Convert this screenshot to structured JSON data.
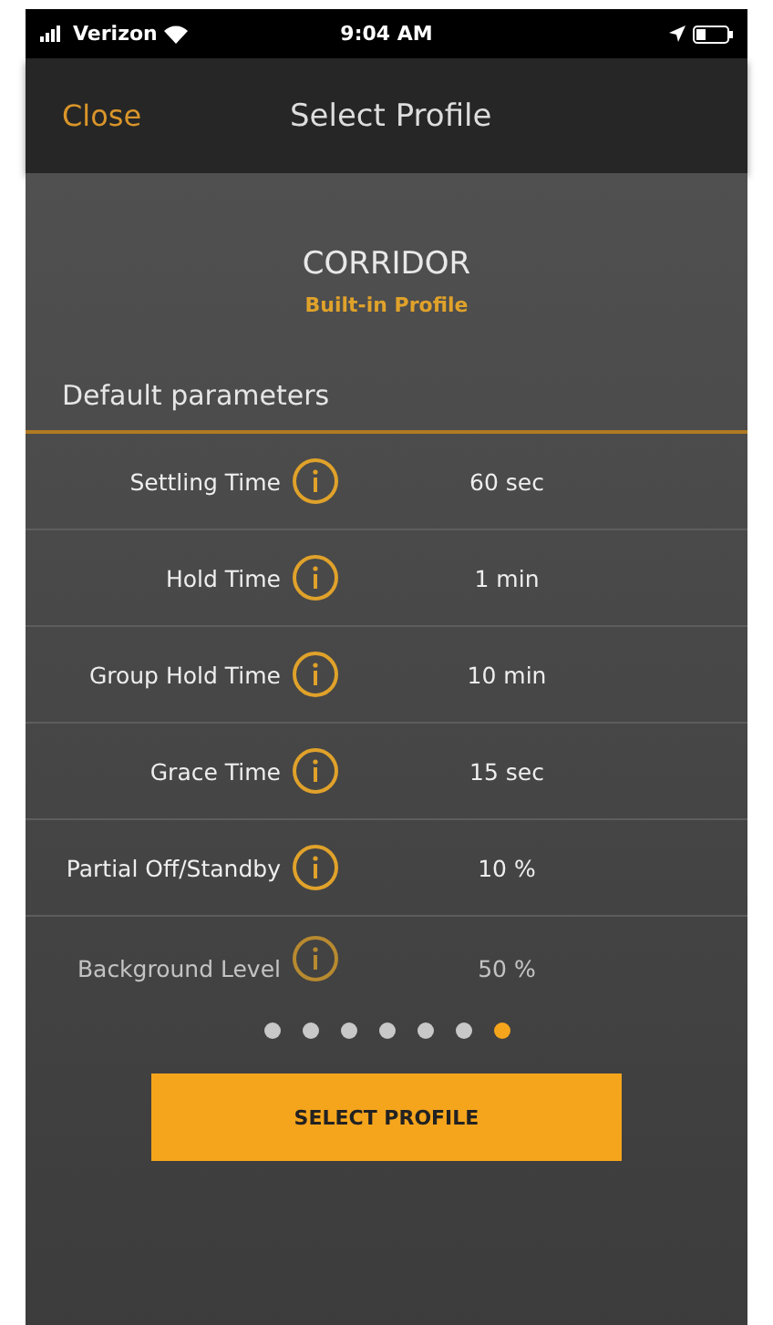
{
  "status_bar": {
    "carrier": "Verizon",
    "time": "9:04 AM"
  },
  "nav": {
    "close": "Close",
    "title": "Select Profile"
  },
  "profile": {
    "name": "CORRIDOR",
    "subtitle": "Built-in Profile"
  },
  "section": "Default parameters",
  "parameters": [
    {
      "label": "Settling Time",
      "value": "60 sec"
    },
    {
      "label": "Hold Time",
      "value": "1 min"
    },
    {
      "label": "Group Hold Time",
      "value": "10 min"
    },
    {
      "label": "Grace Time",
      "value": "15 sec"
    },
    {
      "label": "Partial Off/Standby",
      "value": "10 %"
    },
    {
      "label": "Background Level",
      "value": "50 %"
    }
  ],
  "pages": [
    {
      "selected": false
    },
    {
      "selected": false
    },
    {
      "selected": false
    },
    {
      "selected": false
    },
    {
      "selected": false
    },
    {
      "selected": false
    },
    {
      "selected": true
    }
  ],
  "button": "SELECT PROFILE"
}
